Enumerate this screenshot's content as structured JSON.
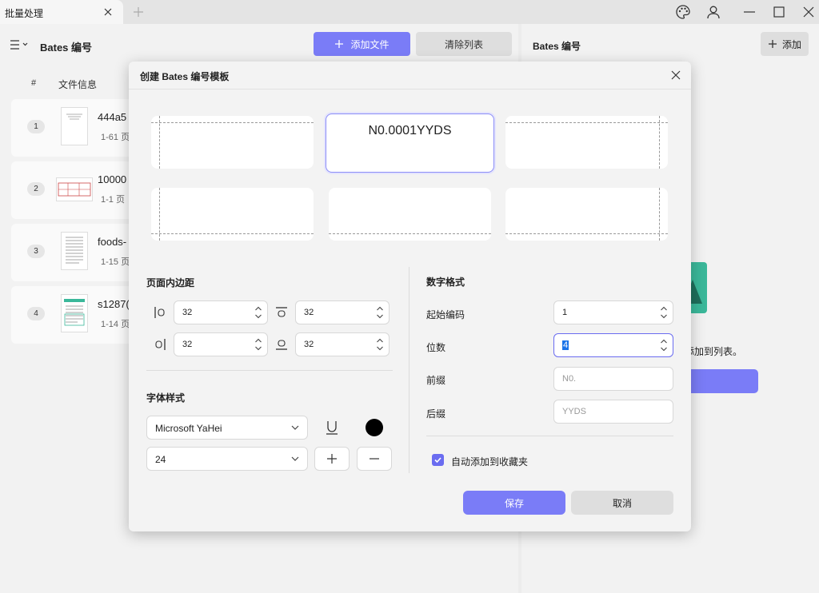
{
  "titlebar": {
    "tab_title": "批量处理",
    "icons": [
      "close-icon",
      "plus-icon",
      "palette-icon",
      "user-icon",
      "minimize-icon",
      "maximize-icon",
      "close-icon"
    ]
  },
  "left_panel": {
    "title": "Bates 编号",
    "add_files_label": "添加文件",
    "clear_list_label": "清除列表",
    "col_number": "#",
    "col_file_info": "文件信息",
    "files": [
      {
        "num": "1",
        "name": "444a5",
        "pages": "1-61 页"
      },
      {
        "num": "2",
        "name": "10000",
        "pages": "1-1 页"
      },
      {
        "num": "3",
        "name": "foods-",
        "pages": "1-15 页"
      },
      {
        "num": "4",
        "name": "s1287(",
        "pages": "1-14 页"
      }
    ]
  },
  "right_panel": {
    "title": "Bates 编号",
    "add_label": "添加",
    "empty_text": "将添加到列表。"
  },
  "modal": {
    "title": "创建 Bates 编号模板",
    "preview_text": "N0.0001YYDS",
    "margin_section": "页面内边距",
    "margins": {
      "left": "32",
      "top": "32",
      "right": "32",
      "bottom": "32"
    },
    "font_section": "字体样式",
    "font_family": "Microsoft YaHei",
    "font_size": "24",
    "font_color": "#000000",
    "number_section": "数字格式",
    "start_label": "起始编码",
    "start_value": "1",
    "digits_label": "位数",
    "digits_value": "4",
    "prefix_label": "前缀",
    "prefix_placeholder": "N0.",
    "suffix_label": "后缀",
    "suffix_placeholder": "YYDS",
    "auto_fav_label": "自动添加到收藏夹",
    "auto_fav_checked": true,
    "save_label": "保存",
    "cancel_label": "取消"
  },
  "colors": {
    "accent": "#7a7cf7",
    "focus": "#6a6cf0",
    "illustration": "#3bb89a"
  }
}
